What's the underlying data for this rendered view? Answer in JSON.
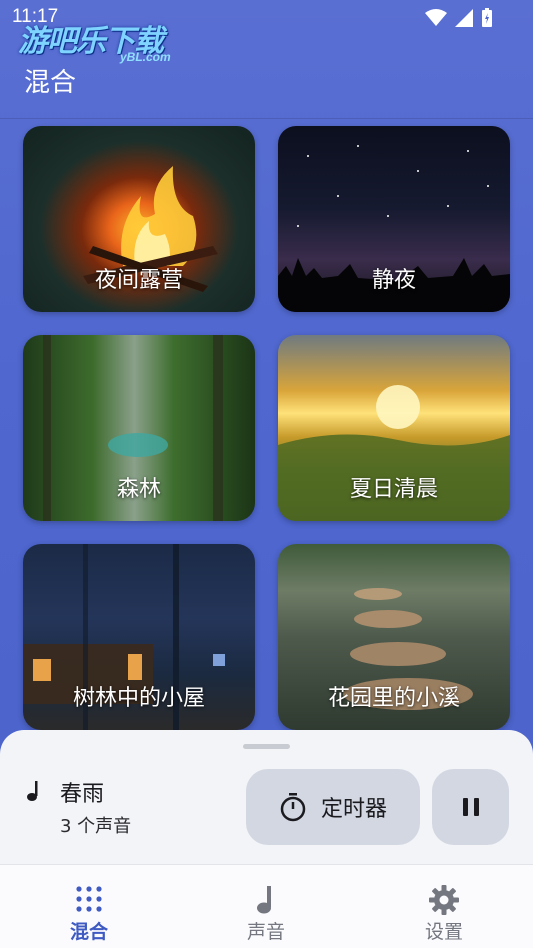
{
  "status_bar": {
    "time": "11:17"
  },
  "watermark": {
    "text": "游吧乐下载",
    "sub": "yBL.com"
  },
  "header": {
    "title": "混合"
  },
  "mixes": [
    {
      "label": "夜间露营",
      "image": "campfire-photo"
    },
    {
      "label": "静夜",
      "image": "starry-night-photo"
    },
    {
      "label": "森林",
      "image": "forest-photo"
    },
    {
      "label": "夏日清晨",
      "image": "summer-morning-photo"
    },
    {
      "label": "树林中的小屋",
      "image": "cabin-in-woods-photo"
    },
    {
      "label": "花园里的小溪",
      "image": "garden-stream-photo"
    }
  ],
  "player": {
    "title": "春雨",
    "subtitle": "3 个声音",
    "timer_label": "定时器"
  },
  "nav": [
    {
      "label": "混合",
      "icon": "grid-dots-icon",
      "active": true
    },
    {
      "label": "声音",
      "icon": "music-note-icon",
      "active": false
    },
    {
      "label": "设置",
      "icon": "gear-icon",
      "active": false
    }
  ],
  "colors": {
    "accent": "#3f5bc2",
    "background": "#4f67cf",
    "sheet": "#f3f4f8"
  }
}
